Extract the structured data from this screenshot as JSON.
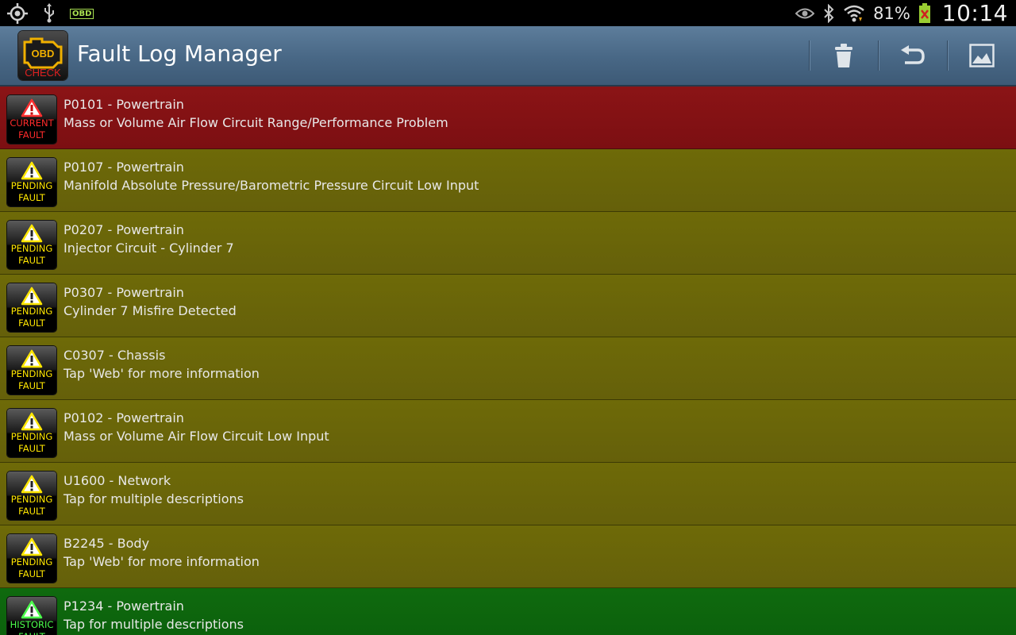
{
  "status_bar": {
    "left_icons": [
      "gps-icon",
      "usb-icon",
      "obd-icon"
    ],
    "obd_label": "OBD",
    "right_icons": [
      "eye-icon",
      "bluetooth-icon",
      "wifi-icon",
      "battery-icon"
    ],
    "battery_percent": "81%",
    "time": "10:14"
  },
  "action_bar": {
    "app_logo_text_top": "OBD",
    "app_logo_text_bottom": "CHECK",
    "title": "Fault Log Manager",
    "actions": [
      "trash-icon",
      "undo-icon",
      "image-icon"
    ]
  },
  "colors": {
    "current": "#8b1416",
    "pending": "#6e6a08",
    "historic": "#0f6a0e",
    "action_bar": "#486785"
  },
  "faults": [
    {
      "status": "current",
      "badge_line1": "CURRENT",
      "badge_line2": "FAULT",
      "title": "P0101 - Powertrain",
      "description": "Mass or Volume Air Flow Circuit Range/Performance Problem"
    },
    {
      "status": "pending",
      "badge_line1": "PENDING",
      "badge_line2": "FAULT",
      "title": "P0107 - Powertrain",
      "description": "Manifold Absolute Pressure/Barometric Pressure Circuit Low Input"
    },
    {
      "status": "pending",
      "badge_line1": "PENDING",
      "badge_line2": "FAULT",
      "title": "P0207 - Powertrain",
      "description": "Injector Circuit - Cylinder 7"
    },
    {
      "status": "pending",
      "badge_line1": "PENDING",
      "badge_line2": "FAULT",
      "title": "P0307 - Powertrain",
      "description": "Cylinder 7 Misfire Detected"
    },
    {
      "status": "pending",
      "badge_line1": "PENDING",
      "badge_line2": "FAULT",
      "title": "C0307 - Chassis",
      "description": "Tap 'Web' for more information"
    },
    {
      "status": "pending",
      "badge_line1": "PENDING",
      "badge_line2": "FAULT",
      "title": "P0102 - Powertrain",
      "description": "Mass or Volume Air Flow Circuit Low Input"
    },
    {
      "status": "pending",
      "badge_line1": "PENDING",
      "badge_line2": "FAULT",
      "title": "U1600 - Network",
      "description": "Tap for multiple descriptions"
    },
    {
      "status": "pending",
      "badge_line1": "PENDING",
      "badge_line2": "FAULT",
      "title": "B2245 - Body",
      "description": "Tap 'Web' for more information"
    },
    {
      "status": "historic",
      "badge_line1": "HISTORIC",
      "badge_line2": "FAULT",
      "title": "P1234 - Powertrain",
      "description": "Tap for multiple descriptions"
    }
  ]
}
